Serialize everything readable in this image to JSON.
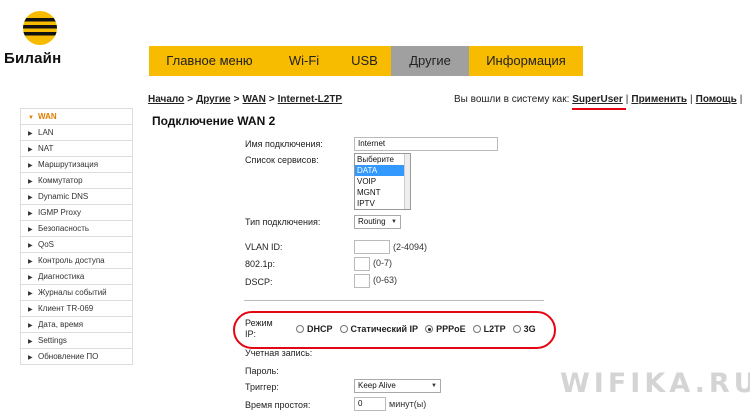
{
  "brand": {
    "name": "Билайн",
    "logo_colors": [
      "#f7bb00",
      "#111111"
    ]
  },
  "topnav": [
    {
      "label": "Главное меню",
      "width": 0
    },
    {
      "label": "Wi-Fi"
    },
    {
      "label": "USB"
    },
    {
      "label": "Другие",
      "active": true
    },
    {
      "label": "Информация"
    }
  ],
  "breadcrumb": [
    "Начало",
    "Другие",
    "WAN",
    "Internet-L2TP"
  ],
  "breadcrumb_sep": ">",
  "login": {
    "prefix": "Вы вошли в систему как:",
    "user": "SuperUser",
    "apply": "Применить",
    "help": "Помощь"
  },
  "sidebar": [
    "WAN",
    "LAN",
    "NAT",
    "Маршрутизация",
    "Коммутатор",
    "Dynamic DNS",
    "IGMP Proxy",
    "Безопасность",
    "QoS",
    "Контроль доступа",
    "Диагностика",
    "Журналы событий",
    "Клиент TR-069",
    "Дата, время",
    "Settings",
    "Обновление ПО"
  ],
  "page_title": "Подключение WAN 2",
  "form": {
    "conn_name_label": "Имя подключения:",
    "conn_name_value": "Internet",
    "services_label": "Список сервисов:",
    "services": [
      "Выберите",
      "DATA",
      "VOIP",
      "MGNT",
      "IPTV"
    ],
    "conn_type_label": "Тип подключения:",
    "conn_type_value": "Routing",
    "vlan_label": "VLAN ID:",
    "vlan_hint": "(2-4094)",
    "p8021_label": "802.1p:",
    "p8021_hint": "(0-7)",
    "dscp_label": "DSCP:",
    "dscp_hint": "(0-63)",
    "ip_mode_label_1": "Режим",
    "ip_mode_label_2": "IP:",
    "ip_modes": [
      "DHCP",
      "Статический IP",
      "PPPoE",
      "L2TP",
      "3G"
    ],
    "ip_mode_selected": "PPPoE",
    "account_label": "Учетная запись:",
    "password_label": "Пароль:",
    "trigger_label": "Триггер:",
    "trigger_value": "Keep Alive",
    "idle_label": "Время простоя:",
    "idle_value": "0",
    "idle_unit": "минут(ы)"
  },
  "watermark": "WIFIKA.RU",
  "colors": {
    "accent_yellow": "#f7bb00",
    "active_tab": "#a0a0a0",
    "highlight_red": "#e30613",
    "sidebar_active": "#e07b00",
    "list_select": "#3399ff"
  }
}
